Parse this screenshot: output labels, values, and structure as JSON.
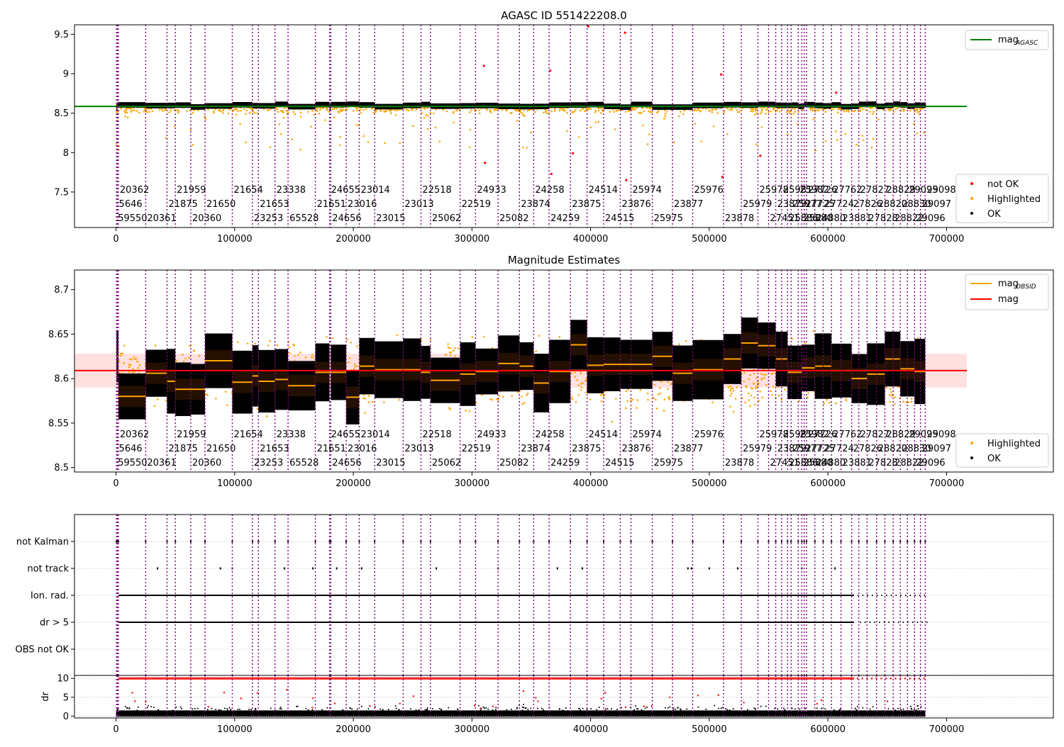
{
  "figure": {
    "title": "AGASC ID 551422208.0",
    "panel2_title": "Magnitude Estimates"
  },
  "x_ticks": [
    0,
    100000,
    200000,
    300000,
    400000,
    500000,
    600000,
    700000
  ],
  "obsids": [
    {
      "x": 400,
      "label": "59550"
    },
    {
      "x": 1200,
      "label": "5646"
    },
    {
      "x": 2000,
      "label": "20362"
    },
    {
      "x": 25000,
      "label": "20361"
    },
    {
      "x": 43000,
      "label": "21875"
    },
    {
      "x": 50000,
      "label": "21959"
    },
    {
      "x": 63000,
      "label": "20360"
    },
    {
      "x": 75000,
      "label": "21650"
    },
    {
      "x": 98000,
      "label": "21654"
    },
    {
      "x": 115000,
      "label": "23253"
    },
    {
      "x": 120000,
      "label": "21653"
    },
    {
      "x": 134000,
      "label": "23338"
    },
    {
      "x": 145000,
      "label": "65528"
    },
    {
      "x": 168000,
      "label": "21651"
    },
    {
      "x": 180000,
      "label": "24655"
    },
    {
      "x": 181000,
      "label": "24656"
    },
    {
      "x": 194000,
      "label": "23016"
    },
    {
      "x": 205000,
      "label": "23014"
    },
    {
      "x": 218000,
      "label": "23015"
    },
    {
      "x": 242000,
      "label": "23013"
    },
    {
      "x": 257000,
      "label": "22518"
    },
    {
      "x": 265000,
      "label": "25062"
    },
    {
      "x": 290000,
      "label": "22519"
    },
    {
      "x": 303000,
      "label": "24933"
    },
    {
      "x": 322000,
      "label": "25082"
    },
    {
      "x": 340000,
      "label": "23874"
    },
    {
      "x": 352000,
      "label": "24258"
    },
    {
      "x": 365000,
      "label": "24259"
    },
    {
      "x": 383000,
      "label": "23875"
    },
    {
      "x": 397000,
      "label": "24514"
    },
    {
      "x": 411000,
      "label": "24515"
    },
    {
      "x": 425000,
      "label": "23876"
    },
    {
      "x": 434000,
      "label": "25974"
    },
    {
      "x": 452000,
      "label": "25975"
    },
    {
      "x": 469000,
      "label": "23877"
    },
    {
      "x": 486000,
      "label": "25976"
    },
    {
      "x": 512000,
      "label": "23878"
    },
    {
      "x": 527000,
      "label": "25979"
    },
    {
      "x": 541000,
      "label": "25978"
    },
    {
      "x": 550000,
      "label": "27451"
    },
    {
      "x": 556000,
      "label": "23879"
    },
    {
      "x": 561000,
      "label": "25981"
    },
    {
      "x": 566000,
      "label": "25886"
    },
    {
      "x": 569000,
      "label": "25977"
    },
    {
      "x": 575000,
      "label": "25982"
    },
    {
      "x": 578000,
      "label": "25880"
    },
    {
      "x": 580000,
      "label": "27725"
    },
    {
      "x": 582000,
      "label": "27726"
    },
    {
      "x": 589000,
      "label": "24880"
    },
    {
      "x": 596000,
      "label": "27724"
    },
    {
      "x": 603000,
      "label": "27762"
    },
    {
      "x": 611000,
      "label": "23881"
    },
    {
      "x": 620000,
      "label": "27826"
    },
    {
      "x": 626000,
      "label": "27827"
    },
    {
      "x": 633000,
      "label": "27828"
    },
    {
      "x": 641000,
      "label": "28820"
    },
    {
      "x": 648000,
      "label": "28829"
    },
    {
      "x": 655000,
      "label": "28822"
    },
    {
      "x": 661000,
      "label": "28830"
    },
    {
      "x": 667000,
      "label": "29095"
    },
    {
      "x": 673000,
      "label": "29096"
    },
    {
      "x": 678000,
      "label": "29097"
    },
    {
      "x": 682000,
      "label": "29098"
    }
  ],
  "chart_data": [
    {
      "type": "scatter",
      "title": "AGASC ID 551422208.0",
      "xlim": [
        -35000,
        790000
      ],
      "ylim": [
        7.05,
        9.62
      ],
      "y_ticks": [
        7.5,
        8.0,
        8.5,
        9.0,
        9.5
      ],
      "reference_line": {
        "name": "mag_AGASC",
        "value": 8.585,
        "x_range": [
          -35000,
          717000
        ],
        "color": "#008000"
      },
      "series": [
        {
          "name": "not OK",
          "color": "#ff0000"
        },
        {
          "name": "Highlighted",
          "color": "#ffa500"
        },
        {
          "name": "OK",
          "color": "#000000"
        }
      ],
      "flagged_points": [
        {
          "x": 310000,
          "y": 9.1
        },
        {
          "x": 311000,
          "y": 7.87
        },
        {
          "x": 366000,
          "y": 9.04
        },
        {
          "x": 367000,
          "y": 7.73
        },
        {
          "x": 385000,
          "y": 7.99
        },
        {
          "x": 398000,
          "y": 9.6
        },
        {
          "x": 429000,
          "y": 9.52
        },
        {
          "x": 430000,
          "y": 7.65
        },
        {
          "x": 510000,
          "y": 8.99
        },
        {
          "x": 511000,
          "y": 7.69
        },
        {
          "x": 543000,
          "y": 7.96
        },
        {
          "x": 607000,
          "y": 8.76
        }
      ],
      "legend": {
        "position": "lower-right",
        "entries": [
          "not OK",
          "Highlighted",
          "OK"
        ]
      },
      "legend_top": {
        "position": "upper-right",
        "label": "mag",
        "sub": "AGASC"
      }
    },
    {
      "type": "scatter",
      "title": "Magnitude Estimates",
      "xlim": [
        -35000,
        790000
      ],
      "ylim": [
        8.495,
        8.722
      ],
      "y_ticks": [
        8.5,
        8.55,
        8.6,
        8.65,
        8.7
      ],
      "mag": {
        "value": 8.609,
        "band": [
          8.59,
          8.628
        ],
        "x_range": [
          -35000,
          717000
        ],
        "color": "#ff0000"
      },
      "obsid_mag": [
        {
          "x0": 400,
          "x1": 2000,
          "v": 8.625
        },
        {
          "x0": 2000,
          "x1": 25000,
          "v": 8.58
        },
        {
          "x0": 25000,
          "x1": 43000,
          "v": 8.606
        },
        {
          "x0": 43000,
          "x1": 50000,
          "v": 8.597
        },
        {
          "x0": 50000,
          "x1": 63000,
          "v": 8.588
        },
        {
          "x0": 63000,
          "x1": 75000,
          "v": 8.588
        },
        {
          "x0": 75000,
          "x1": 98000,
          "v": 8.62
        },
        {
          "x0": 98000,
          "x1": 115000,
          "v": 8.596
        },
        {
          "x0": 115000,
          "x1": 120000,
          "v": 8.603
        },
        {
          "x0": 120000,
          "x1": 134000,
          "v": 8.597
        },
        {
          "x0": 134000,
          "x1": 145000,
          "v": 8.599
        },
        {
          "x0": 145000,
          "x1": 168000,
          "v": 8.592
        },
        {
          "x0": 168000,
          "x1": 180000,
          "v": 8.607
        },
        {
          "x0": 181000,
          "x1": 194000,
          "v": 8.607
        },
        {
          "x0": 194000,
          "x1": 205000,
          "v": 8.579
        },
        {
          "x0": 205000,
          "x1": 218000,
          "v": 8.614
        },
        {
          "x0": 218000,
          "x1": 242000,
          "v": 8.61
        },
        {
          "x0": 242000,
          "x1": 257000,
          "v": 8.61
        },
        {
          "x0": 257000,
          "x1": 265000,
          "v": 8.607
        },
        {
          "x0": 265000,
          "x1": 290000,
          "v": 8.598
        },
        {
          "x0": 290000,
          "x1": 303000,
          "v": 8.605
        },
        {
          "x0": 303000,
          "x1": 322000,
          "v": 8.608
        },
        {
          "x0": 322000,
          "x1": 340000,
          "v": 8.617
        },
        {
          "x0": 340000,
          "x1": 352000,
          "v": 8.614
        },
        {
          "x0": 352000,
          "x1": 365000,
          "v": 8.595
        },
        {
          "x0": 365000,
          "x1": 383000,
          "v": 8.608
        },
        {
          "x0": 383000,
          "x1": 397000,
          "v": 8.638
        },
        {
          "x0": 397000,
          "x1": 411000,
          "v": 8.615
        },
        {
          "x0": 411000,
          "x1": 425000,
          "v": 8.616
        },
        {
          "x0": 425000,
          "x1": 452000,
          "v": 8.616
        },
        {
          "x0": 452000,
          "x1": 469000,
          "v": 8.625
        },
        {
          "x0": 469000,
          "x1": 486000,
          "v": 8.606
        },
        {
          "x0": 486000,
          "x1": 512000,
          "v": 8.61
        },
        {
          "x0": 512000,
          "x1": 527000,
          "v": 8.622
        },
        {
          "x0": 527000,
          "x1": 541000,
          "v": 8.64
        },
        {
          "x0": 541000,
          "x1": 556000,
          "v": 8.637
        },
        {
          "x0": 556000,
          "x1": 566000,
          "v": 8.622
        },
        {
          "x0": 566000,
          "x1": 578000,
          "v": 8.607
        },
        {
          "x0": 578000,
          "x1": 589000,
          "v": 8.612
        },
        {
          "x0": 589000,
          "x1": 603000,
          "v": 8.614
        },
        {
          "x0": 603000,
          "x1": 620000,
          "v": 8.609
        },
        {
          "x0": 620000,
          "x1": 633000,
          "v": 8.6
        },
        {
          "x0": 633000,
          "x1": 648000,
          "v": 8.605
        },
        {
          "x0": 648000,
          "x1": 661000,
          "v": 8.622
        },
        {
          "x0": 661000,
          "x1": 673000,
          "v": 8.611
        },
        {
          "x0": 673000,
          "x1": 682000,
          "v": 8.608
        }
      ],
      "legend": {
        "position": "lower-right",
        "entries": [
          "Highlighted",
          "OK"
        ]
      },
      "legend_top": {
        "position": "upper-right",
        "entries": [
          {
            "label": "mag",
            "sub": "OBSID",
            "color": "#ffa500"
          },
          {
            "label": "mag",
            "sub": "",
            "color": "#ff0000"
          }
        ]
      }
    },
    {
      "type": "scatter",
      "xlim": [
        -35000,
        790000
      ],
      "categories": [
        "not Kalman",
        "not track",
        "Ion. rad.",
        "dr > 5",
        "OBS not OK"
      ],
      "flags": {
        "ion_rad_extent": [
          2000,
          622000
        ],
        "dr5_extent": [
          2000,
          622000
        ],
        "not_track_x": [
          35000,
          88000,
          98000,
          142000,
          166000,
          186000,
          207000,
          270000,
          322000,
          372000,
          393000,
          482000,
          485000,
          500000,
          524000,
          578000,
          606000
        ]
      }
    },
    {
      "type": "scatter",
      "xlim": [
        -35000,
        790000
      ],
      "ylabel": "dr",
      "y_ticks": [
        0,
        5,
        10
      ],
      "ylim": [
        -0.5,
        10.8
      ]
    }
  ],
  "axes": {
    "panel4_ylabel": "dr"
  }
}
